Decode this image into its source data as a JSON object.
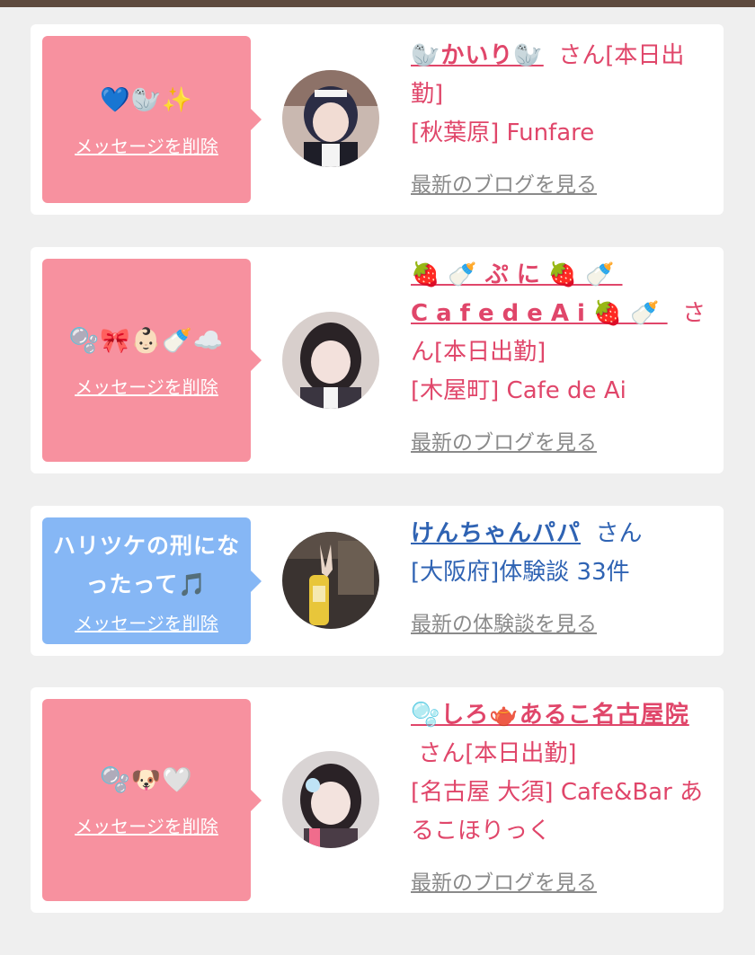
{
  "colors": {
    "pink_bubble": "#f7919f",
    "blue_bubble": "#86b7f5",
    "pink_text": "#e0466a",
    "blue_text": "#2f63b3",
    "topbar": "#5e4a3e"
  },
  "items": [
    {
      "bubble_message": "💙🦭✨",
      "delete_label": "メッセージを削除",
      "name": "🦭かいり🦭",
      "suffix": "さん[本日出勤]",
      "shop": "[秋葉原] Funfare",
      "link": "最新のブログを見る"
    },
    {
      "bubble_message": "🫧🎀👶🏻🍼☁️",
      "delete_label": "メッセージを削除",
      "name": "🍓🍼ぷに🍓🍼CafedeAi🍓🍼",
      "suffix": "さん[本日出勤]",
      "shop": "[木屋町] Cafe de Ai",
      "link": "最新のブログを見る"
    },
    {
      "bubble_message": "ハリツケの刑になったって🎵",
      "delete_label": "メッセージを削除",
      "name": "けんちゃんパパ",
      "suffix": "さん",
      "shop": "[大阪府]体験談 33件",
      "link": "最新の体験談を見る"
    },
    {
      "bubble_message": "🫧🐶🤍",
      "delete_label": "メッセージを削除",
      "name": "🫧しろ🫖あるこ名古屋院",
      "suffix": "さん[本日出勤]",
      "shop": "[名古屋 大須] Cafe&Bar あるこほりっく",
      "link": "最新のブログを見る"
    }
  ]
}
